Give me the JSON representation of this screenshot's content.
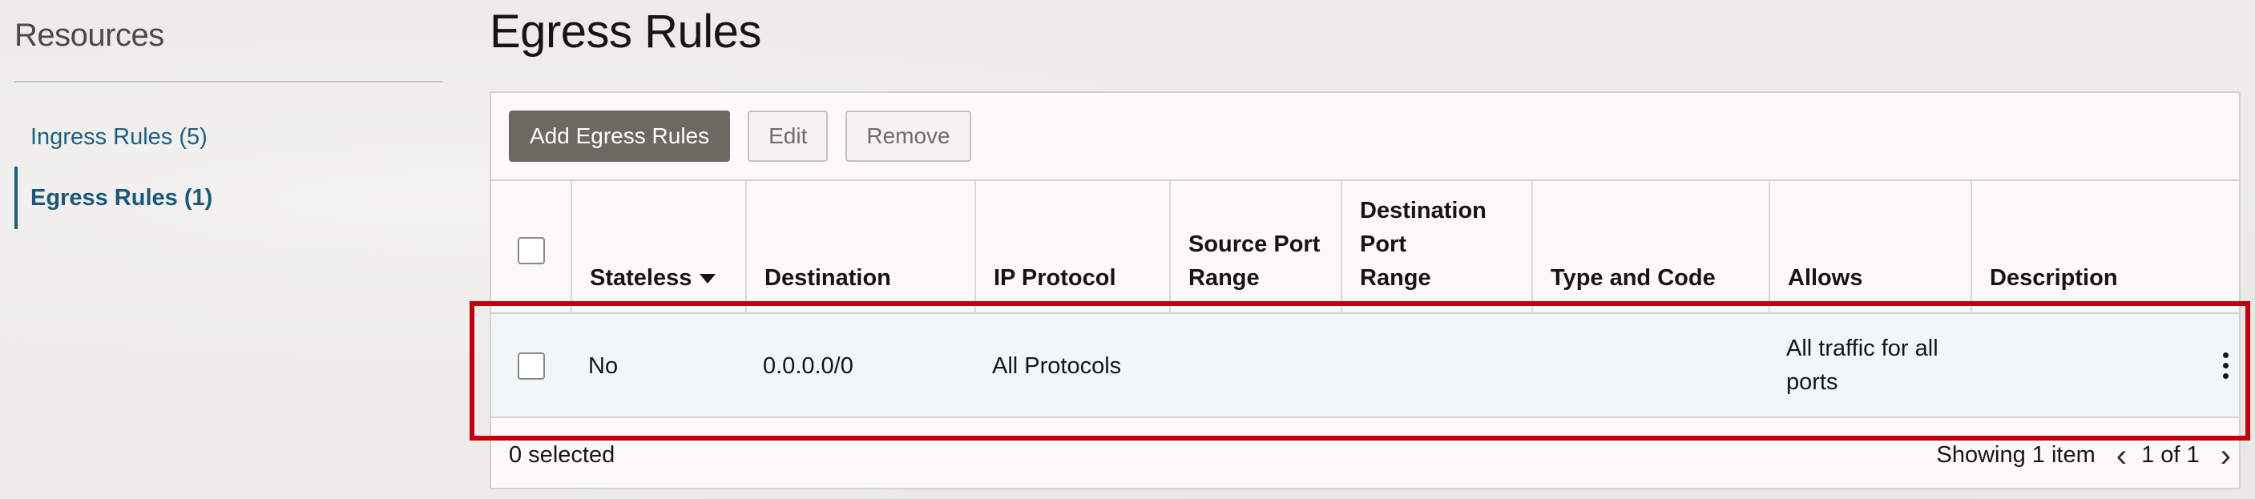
{
  "sidebar": {
    "title": "Resources",
    "items": [
      {
        "label": "Ingress Rules (5)",
        "active": false
      },
      {
        "label": "Egress Rules (1)",
        "active": true
      }
    ]
  },
  "page": {
    "title": "Egress Rules"
  },
  "toolbar": {
    "add_label": "Add Egress Rules",
    "edit_label": "Edit",
    "remove_label": "Remove"
  },
  "table": {
    "headers": {
      "stateless": "Stateless",
      "destination": "Destination",
      "ip_protocol": "IP Protocol",
      "source_port_line1": "Source Port",
      "source_port_line2": "Range",
      "dest_port_line1": "Destination",
      "dest_port_line2": "Port",
      "dest_port_line3": "Range",
      "type_code": "Type and Code",
      "allows": "Allows",
      "description": "Description"
    },
    "rows": [
      {
        "stateless": "No",
        "destination": "0.0.0.0/0",
        "ip_protocol": "All Protocols",
        "source_port_range": "",
        "destination_port_range": "",
        "type_and_code": "",
        "allows_line1": "All traffic for all",
        "allows_line2": "ports",
        "description": ""
      }
    ]
  },
  "footer": {
    "selected": "0 selected",
    "showing": "Showing 1 item",
    "page_indicator": "1 of 1"
  },
  "icons": {
    "sort": "caret-down-icon",
    "prev": "chevron-left-icon",
    "next": "chevron-right-icon",
    "row_menu": "kebab-menu-icon"
  },
  "colors": {
    "link": "#1c5f80",
    "primary_button": "#6e6862",
    "row_highlight_bg": "#f1f6f9",
    "annotation_box": "#c0000a"
  }
}
